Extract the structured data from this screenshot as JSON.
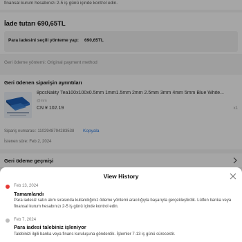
{
  "top_strip": {
    "text": "finansal kurum hesabınızı 2-5 iş günü içinde kontrol edin."
  },
  "refund": {
    "total_label": "İade tutarı 690,65TL",
    "method_label": "Para iadesini seçili yönteme yap:",
    "method_value": "690,65TL",
    "method_note": "Geri ödeme yöntemi: Original payment method"
  },
  "items": {
    "title": "Geri ödenen siparişin ayrıntıları",
    "product": {
      "name": "8pcsNality Tea100x100x0.5mm 1mm1.5mm 2mm 2.5mm 3mm 4mm 5mm Blue White...",
      "variant": "@mm",
      "price": "CN ¥ 102.19",
      "qty": "x1"
    },
    "order_number": "Sipariş numarası: 1102948794283538",
    "copy_label": "Kopyala",
    "request_date": "İstenen süre: Feb 2, 2024"
  },
  "history": {
    "label": "Geri ödeme geçmişi"
  },
  "sheet": {
    "title": "View History",
    "entries": [
      {
        "date": "Feb 13, 2024",
        "title": "Tamamlandı",
        "desc": "Para iadesiz satın alım sırasında kullandığınız ödeme yöntemi aracılığıyla başarıyla gerçekleştirdik. Lütfen banka veya finansal kurum hesabınızı 2-5 iş günü içinde kontrol edin."
      },
      {
        "date": "Feb 7, 2024",
        "title": "Para iadesi talebiniz işleniyor",
        "desc": "Talebinizi ilgili banka veya finans kuruluşuna gönderdik. İşlemler 7-13 iş günü sürecektir."
      }
    ]
  },
  "colors": {
    "accent": "#2a7ae2",
    "active_dot": "#e53935",
    "inactive_dot": "#bdbdbd"
  },
  "icons": {
    "close": "close-icon",
    "chevron": "chevron-right-icon"
  }
}
